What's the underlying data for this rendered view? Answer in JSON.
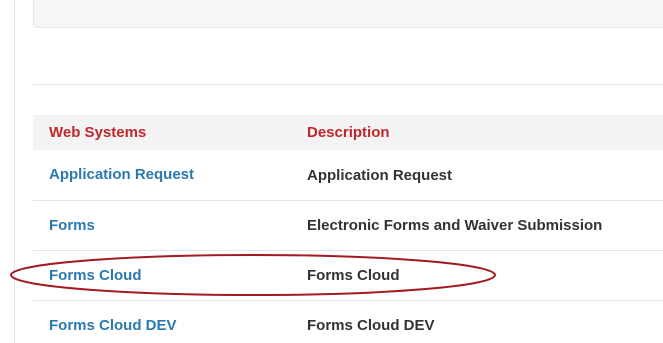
{
  "table": {
    "headers": {
      "systems": "Web Systems",
      "description": "Description"
    },
    "rows": [
      {
        "system": "Application Request",
        "description": "Application Request"
      },
      {
        "system": "Forms",
        "description": "Electronic Forms and Waiver Submission"
      },
      {
        "system": "Forms Cloud",
        "description": "Forms Cloud"
      },
      {
        "system": "Forms Cloud DEV",
        "description": "Forms Cloud DEV"
      }
    ]
  },
  "colors": {
    "header_text": "#c0272d",
    "link_text": "#2a7ab0",
    "annotation_ellipse": "#a3191f"
  }
}
